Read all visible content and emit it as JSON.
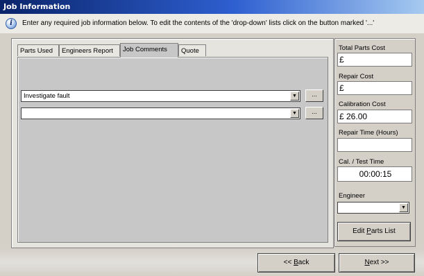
{
  "window": {
    "title": "Job Information"
  },
  "info": {
    "icon": "info-icon",
    "text": "Enter any required job information below. To edit the contents of the 'drop-down' lists click on the button marked '...'"
  },
  "tabs": [
    {
      "label": "Parts Used"
    },
    {
      "label": "Engineers Report"
    },
    {
      "label": "Job Comments",
      "active": true
    },
    {
      "label": "Quote"
    }
  ],
  "comments": [
    {
      "value": "Investigate fault",
      "edit_label": "..."
    },
    {
      "value": "",
      "edit_label": "..."
    }
  ],
  "summary": {
    "total_parts_cost": {
      "label": "Total Parts Cost",
      "value": "£"
    },
    "repair_cost": {
      "label": "Repair Cost",
      "value": "£"
    },
    "calibration_cost": {
      "label": "Calibration Cost",
      "value": "£ 26.00"
    },
    "repair_time": {
      "label": "Repair Time (Hours)",
      "value": ""
    },
    "cal_test_time": {
      "label": "Cal. / Test Time",
      "value": "00:00:15"
    },
    "engineer": {
      "label": "Engineer",
      "value": ""
    }
  },
  "buttons": {
    "edit_parts_list": {
      "pre": "Edit ",
      "key": "P",
      "post": "arts List"
    },
    "back": {
      "pre": "<< ",
      "key": "B",
      "post": "ack"
    },
    "next": {
      "pre": "",
      "key": "N",
      "post": "ext >>"
    }
  }
}
